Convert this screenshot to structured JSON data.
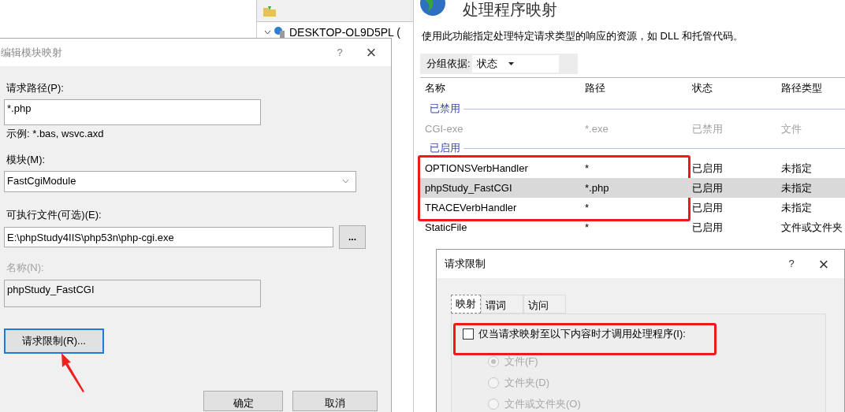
{
  "tree": {
    "server": "DESKTOP-OL9D5PL ("
  },
  "feature": {
    "title": "处理程序映射",
    "description": "使用此功能指定处理特定请求类型的响应的资源，如 DLL 和托管代码。",
    "group_label": "分组依据:",
    "group_value": "状态"
  },
  "table": {
    "columns": [
      "名称",
      "路径",
      "状态",
      "路径类型"
    ],
    "groups": [
      {
        "label": "已禁用",
        "rows": [
          {
            "cells": [
              "CGI-exe",
              "*.exe",
              "已禁用",
              "文件"
            ],
            "disabled": true,
            "selected": false
          }
        ]
      },
      {
        "label": "已启用",
        "rows": [
          {
            "cells": [
              "OPTIONSVerbHandler",
              "*",
              "已启用",
              "未指定"
            ],
            "disabled": false,
            "selected": false
          },
          {
            "cells": [
              "phpStudy_FastCGI",
              "*.php",
              "已启用",
              "未指定"
            ],
            "disabled": false,
            "selected": true
          },
          {
            "cells": [
              "TRACEVerbHandler",
              "*",
              "已启用",
              "未指定"
            ],
            "disabled": false,
            "selected": false
          },
          {
            "cells": [
              "StaticFile",
              "*",
              "已启用",
              "文件或文件夹"
            ],
            "disabled": false,
            "selected": false
          }
        ]
      }
    ]
  },
  "edit_dialog": {
    "title": "编辑模块映射",
    "help": "?",
    "close": "×",
    "request_path_label": "请求路径(P):",
    "request_path": "*.php",
    "example": "示例: *.bas, wsvc.axd",
    "module_label": "模块(M):",
    "module": "FastCgiModule",
    "executable_label": "可执行文件(可选)(E):",
    "executable": "E:\\phpStudy4IIS\\php53n\\php-cgi.exe",
    "browse": "...",
    "name_label": "名称(N):",
    "name": "phpStudy_FastCGI",
    "name_disabled": true,
    "restrictions_button": "请求限制(R)...",
    "ok": "确定",
    "cancel": "取消"
  },
  "restrictions_dialog": {
    "title": "请求限制",
    "help": "?",
    "close": "×",
    "tabs": [
      {
        "label": "映射",
        "selected": true
      },
      {
        "label": "谓词",
        "selected": false
      },
      {
        "label": "访问",
        "selected": false
      }
    ],
    "checkbox": {
      "label": "仅当请求映射至以下内容时才调用处理程序(I):",
      "checked": false
    },
    "options": [
      {
        "label": "文件(F)",
        "selected": true,
        "disabled": true
      },
      {
        "label": "文件夹(D)",
        "selected": false,
        "disabled": true
      },
      {
        "label": "文件或文件夹(O)",
        "selected": false,
        "disabled": true
      }
    ]
  }
}
